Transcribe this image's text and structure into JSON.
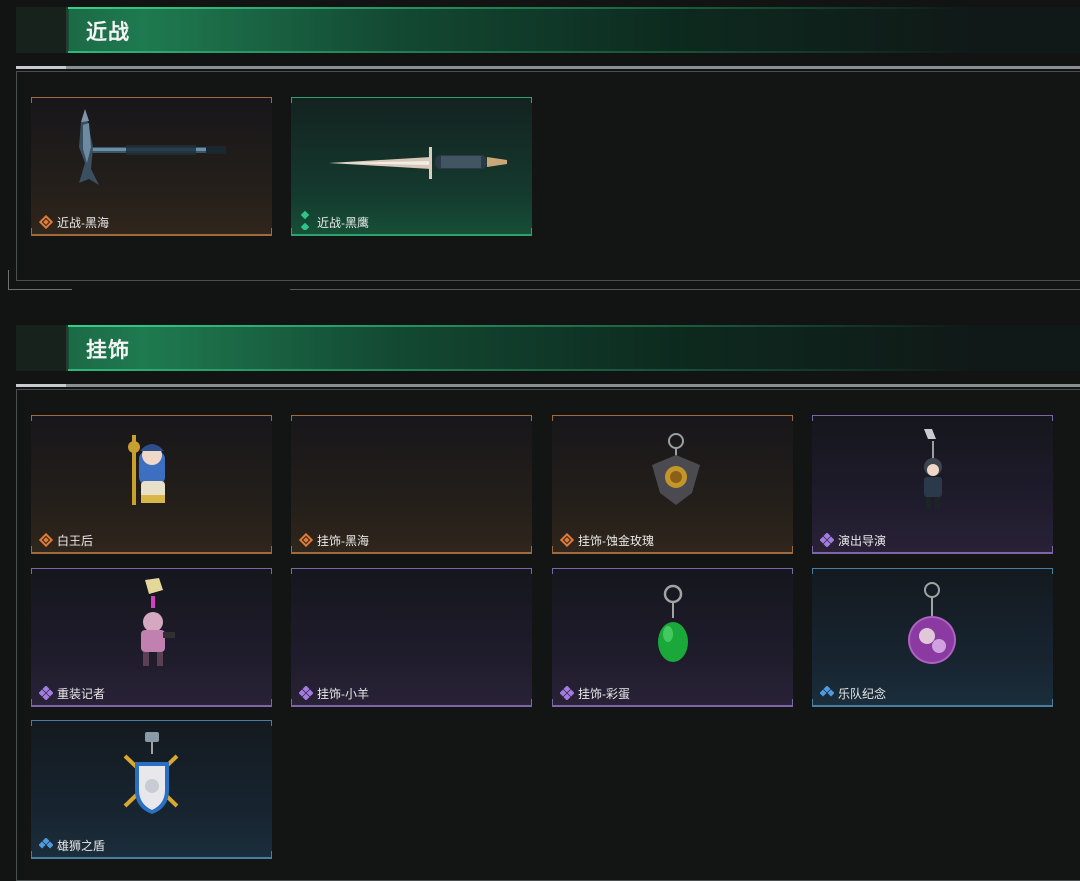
{
  "sections": {
    "melee": {
      "title": "近战",
      "items": [
        {
          "name": "近战-黑海",
          "rarity": "orange"
        },
        {
          "name": "近战-黑鹰",
          "rarity": "green"
        }
      ]
    },
    "charms": {
      "title": "挂饰",
      "items": [
        {
          "name": "白王后",
          "rarity": "orange"
        },
        {
          "name": "挂饰-黑海",
          "rarity": "orange"
        },
        {
          "name": "挂饰-蚀金玫瑰",
          "rarity": "orange"
        },
        {
          "name": "演出导演",
          "rarity": "purple"
        },
        {
          "name": "重装记者",
          "rarity": "purple"
        },
        {
          "name": "挂饰-小羊",
          "rarity": "purple"
        },
        {
          "name": "挂饰-彩蛋",
          "rarity": "purple"
        },
        {
          "name": "乐队纪念",
          "rarity": "blue"
        },
        {
          "name": "雄狮之盾",
          "rarity": "blue"
        }
      ]
    }
  },
  "colors": {
    "orange": "#e07a3a",
    "green": "#2fc488",
    "purple": "#a47be0",
    "blue": "#4f9be0",
    "header_accent": "#1f7a50"
  }
}
